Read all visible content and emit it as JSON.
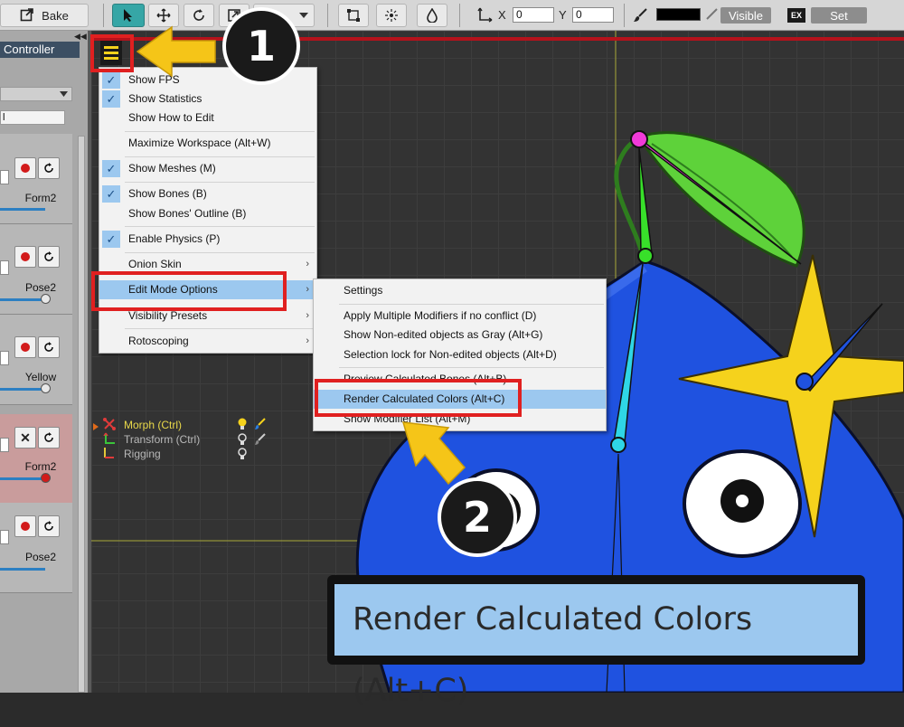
{
  "toolbar": {
    "bake_label": "Bake",
    "x_label": "X",
    "x_value": "0",
    "y_label": "Y",
    "y_value": "0",
    "visible_label": "Visible",
    "ex_label": "EX",
    "set_label": "Set",
    "color_swatch": "#000000"
  },
  "left_panel": {
    "tab_label": "Controller",
    "input_value": "l",
    "cards": [
      {
        "label": "Form2",
        "state": "record"
      },
      {
        "label": "Pose2",
        "state": "record"
      },
      {
        "label": "Yellow",
        "state": "record"
      },
      {
        "label": "Form2",
        "state": "close"
      },
      {
        "label": "Pose2",
        "state": "record"
      }
    ]
  },
  "menu": {
    "items": [
      {
        "label": "Show FPS",
        "checked": true
      },
      {
        "label": "Show Statistics",
        "checked": true
      },
      {
        "label": "Show How to Edit",
        "checked": false
      },
      {
        "label": "Maximize Workspace (Alt+W)",
        "checked": false
      },
      {
        "label": "Show Meshes (M)",
        "checked": true
      },
      {
        "label": "Show Bones (B)",
        "checked": true
      },
      {
        "label": "Show Bones' Outline (B)",
        "checked": false
      },
      {
        "label": "Enable Physics (P)",
        "checked": true
      },
      {
        "label": "Onion Skin",
        "checked": false,
        "submenu": true
      },
      {
        "label": "Edit Mode Options",
        "checked": false,
        "submenu": true
      },
      {
        "label": "Visibility Presets",
        "checked": false,
        "submenu": true
      },
      {
        "label": "Rotoscoping",
        "checked": false,
        "submenu": true
      }
    ]
  },
  "submenu": {
    "items": [
      {
        "label": "Settings"
      },
      {
        "label": "Apply Multiple Modifiers if no conflict (D)"
      },
      {
        "label": "Show Non-edited objects as Gray (Alt+G)"
      },
      {
        "label": "Selection lock for Non-edited objects (Alt+D)"
      },
      {
        "label": "Preview Calculated Bones (Alt+B)"
      },
      {
        "label": "Render Calculated Colors (Alt+C)"
      },
      {
        "label": "Show Modifier List (Alt+M)"
      }
    ]
  },
  "layers": [
    {
      "label": "Morph (Ctrl)",
      "color": "#e8d84a"
    },
    {
      "label": "Transform (Ctrl)",
      "color": "#b8b8b8"
    },
    {
      "label": "Rigging",
      "color": "#b8b8b8"
    }
  ],
  "callouts": {
    "step1": "1",
    "step2": "2",
    "zoom_text": "Render Calculated Colors (Alt+C)"
  },
  "colors": {
    "accent_highlight": "#9cc8ef",
    "red_frame": "#e02020",
    "arrow_yellow": "#f5c518",
    "character_blue": "#1f52e0"
  }
}
